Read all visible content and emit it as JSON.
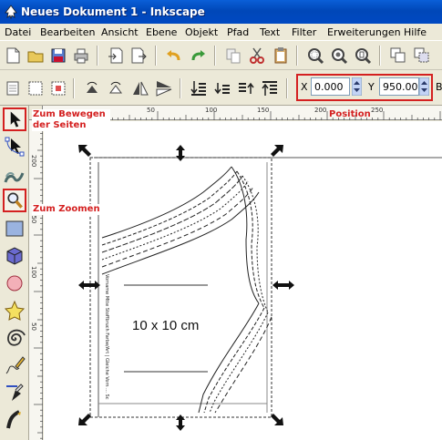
{
  "window": {
    "title": "Neues Dokument 1 - Inkscape"
  },
  "menu": [
    "Datei",
    "Bearbeiten",
    "Ansicht",
    "Ebene",
    "Objekt",
    "Pfad",
    "Text",
    "Filter",
    "Erweiterungen",
    "Hilfe"
  ],
  "position": {
    "x_label": "X",
    "x_value": "0.000",
    "y_label": "Y",
    "y_value": "950.000",
    "trailing_label": "B"
  },
  "ruler": {
    "h_labels": [
      "50",
      "100",
      "150",
      "200",
      "250"
    ],
    "v_labels": [
      "200",
      "150",
      "100",
      "50"
    ]
  },
  "canvas": {
    "shape_text": "10 x 10 cm",
    "vertical_note": "Vorname Mtte Stoffbruch Farbe/Art | Gleiche Vorn ... Sc"
  },
  "annotations": {
    "move": "Zum Bewegen der Seiten",
    "zoom": "Zum Zoomen",
    "position": "Position"
  },
  "colors": {
    "title_bar": "#0047b8",
    "annotation": "#d42020",
    "chrome": "#ece9d8"
  }
}
